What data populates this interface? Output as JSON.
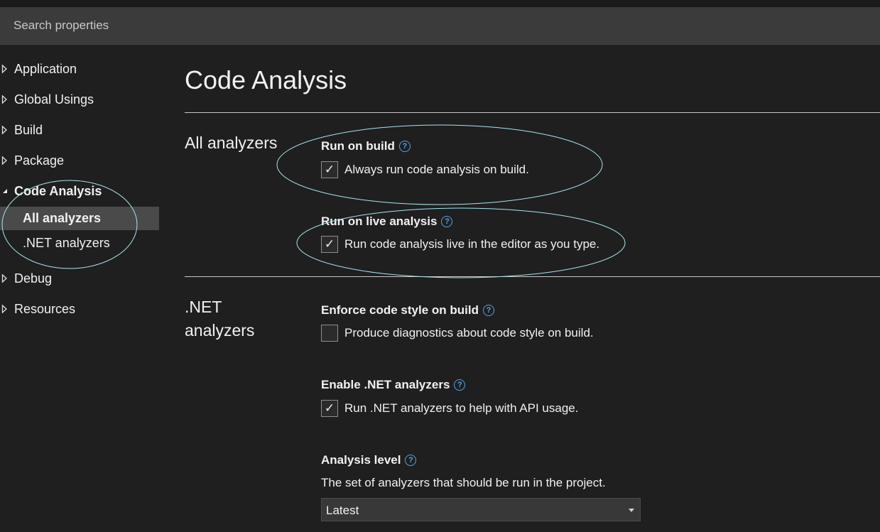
{
  "search": {
    "placeholder": "Search properties"
  },
  "sidebar": {
    "items": [
      {
        "label": "Application",
        "expanded": false
      },
      {
        "label": "Global Usings",
        "expanded": false
      },
      {
        "label": "Build",
        "expanded": false
      },
      {
        "label": "Package",
        "expanded": false
      },
      {
        "label": "Code Analysis",
        "expanded": true,
        "children": [
          {
            "label": "All analyzers",
            "selected": true
          },
          {
            "label": ".NET analyzers",
            "selected": false
          }
        ]
      },
      {
        "label": "Debug",
        "expanded": false
      },
      {
        "label": "Resources",
        "expanded": false
      }
    ]
  },
  "main": {
    "title": "Code Analysis",
    "sections": [
      {
        "title": "All analyzers",
        "properties": [
          {
            "title": "Run on build",
            "checkbox_label": "Always run code analysis on build.",
            "checked": true
          },
          {
            "title": "Run on live analysis",
            "checkbox_label": "Run code analysis live in the editor as you type.",
            "checked": true
          }
        ]
      },
      {
        "title": ".NET analyzers",
        "properties": [
          {
            "title": "Enforce code style on build",
            "checkbox_label": "Produce diagnostics about code style on build.",
            "checked": false
          },
          {
            "title": "Enable .NET analyzers",
            "checkbox_label": "Run .NET analyzers to help with API usage.",
            "checked": true
          },
          {
            "title": "Analysis level",
            "description": "The set of analyzers that should be run in the project.",
            "value": "Latest"
          }
        ]
      }
    ]
  },
  "icons": {
    "help": "help-circle-icon",
    "collapsed": "triangle-right-outline-icon",
    "expanded": "triangle-down-filled-icon",
    "check": "checkmark-icon",
    "dropdown": "chevron-down-icon"
  },
  "colors": {
    "background": "#1f1f1f",
    "search_bar": "#3b3b3b",
    "selected_item": "#4a4a4a",
    "help_icon": "#4ea6e9",
    "annotation": "#a8e6f0"
  }
}
